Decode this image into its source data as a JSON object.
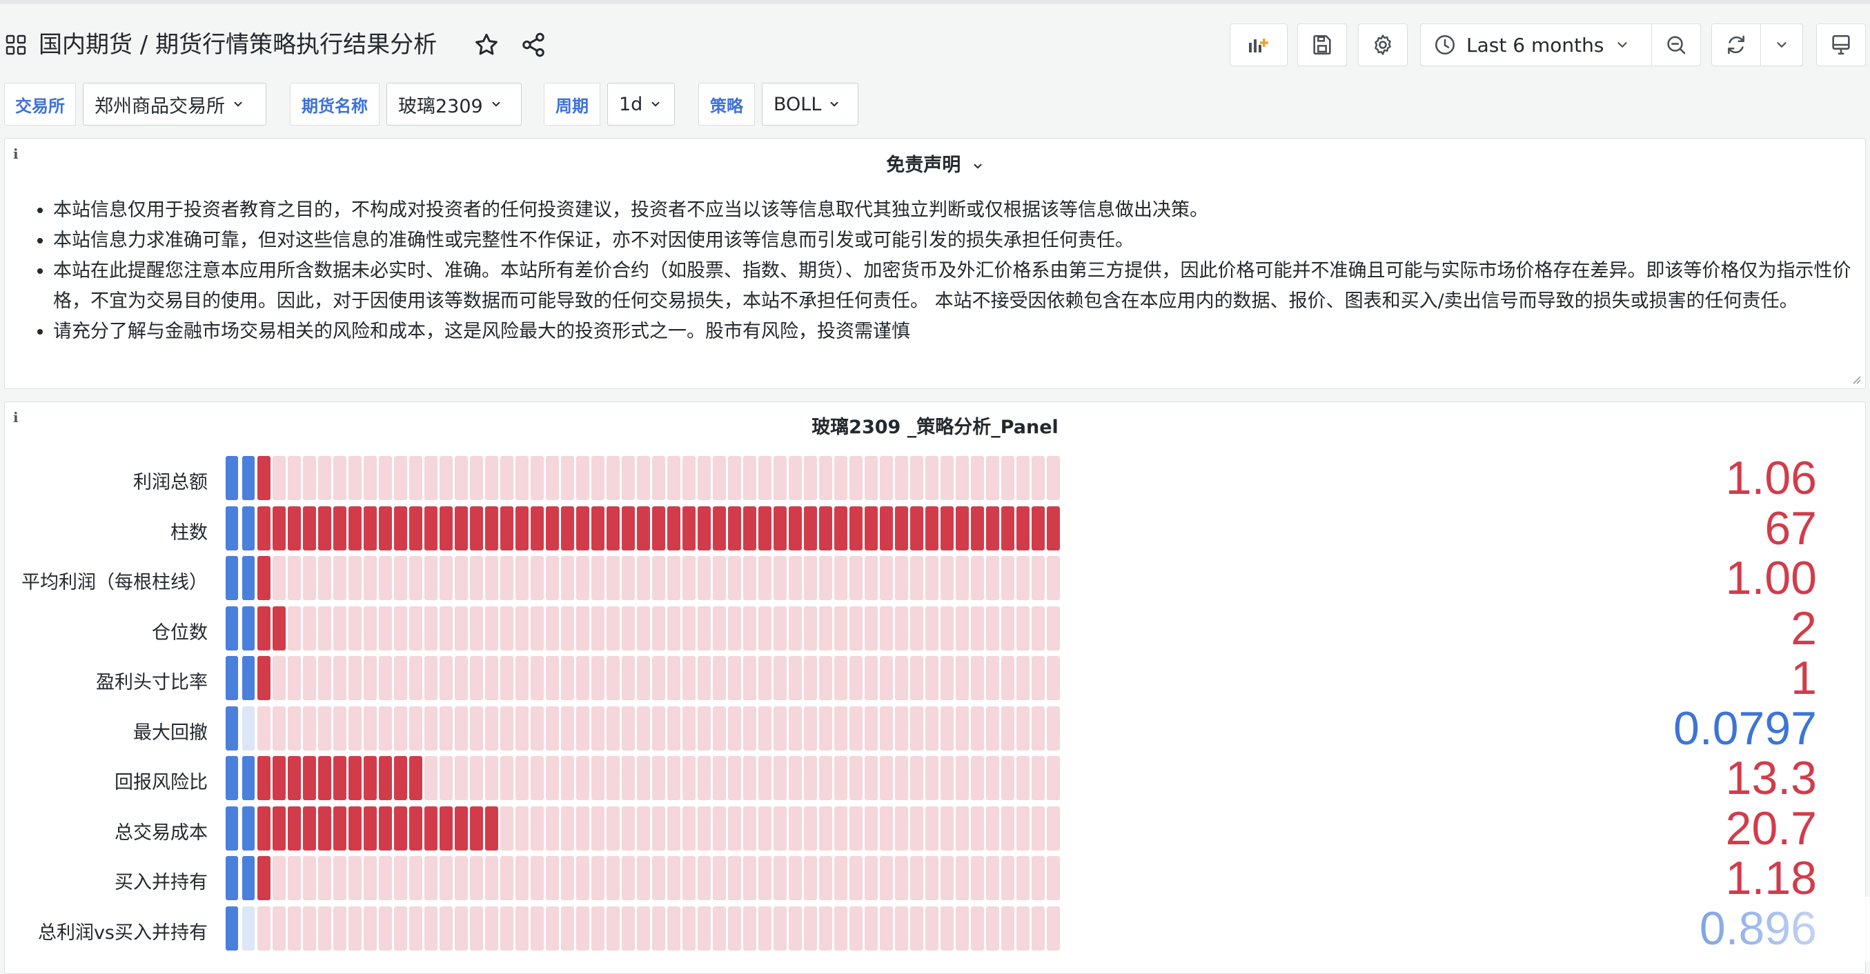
{
  "header": {
    "title": "国内期货  / 期货行情策略执行结果分析",
    "time_range": "Last 6 months"
  },
  "variables": [
    {
      "label": "交易所",
      "value": "郑州商品交易所"
    },
    {
      "label": "期货名称",
      "value": "玻璃2309"
    },
    {
      "label": "周期",
      "value": "1d"
    },
    {
      "label": "策略",
      "value": "BOLL"
    }
  ],
  "disclaimer": {
    "title": "免责声明",
    "items": [
      "本站信息仅用于投资者教育之目的，不构成对投资者的任何投资建议，投资者不应当以该等信息取代其独立判断或仅根据该等信息做出决策。",
      "本站信息力求准确可靠，但对这些信息的准确性或完整性不作保证，亦不对因使用该等信息而引发或可能引发的损失承担任何责任。",
      "本站在此提醒您注意本应用所含数据未必实时、准确。本站所有差价合约（如股票、指数、期货）、加密货币及外汇价格系由第三方提供，因此价格可能并不准确且可能与实际市场价格存在差异。即该等价格仅为指示性价格，不宜为交易目的使用。因此，对于因使用该等数据而可能导致的任何交易损失，本站不承担任何责任。 本站不接受因依赖包含在本应用内的数据、报价、图表和买入/卖出信号而导致的损失或损害的任何责任。",
      "请充分了解与金融市场交易相关的风险和成本，这是风险最大的投资形式之一。股市有风险，投资需谨慎"
    ]
  },
  "panel": {
    "title": "玻璃2309 _策略分析_Panel"
  },
  "colors": {
    "red": "#d23c4a",
    "red_light": "#f5d6da",
    "blue": "#4a7fdc",
    "blue_light": "#dbe6f7",
    "red_text": "#d23c4a",
    "blue_text": "#3e74d6"
  },
  "chart_data": {
    "type": "bar",
    "categories": [
      "利润总额",
      "柱数",
      "平均利润（每根柱线）",
      "仓位数",
      "盈利头寸比率",
      "最大回撤",
      "回报风险比",
      "总交易成本",
      "买入并持有",
      "总利润vs买入并持有"
    ],
    "value_labels": [
      "1.06",
      "67",
      "1.00",
      "2",
      "1",
      "0.0797",
      "13.3",
      "20.7",
      "1.18",
      "0.896"
    ],
    "values": [
      1.06,
      67,
      1.0,
      2,
      1,
      0.0797,
      13.3,
      20.7,
      1.18,
      0.896
    ],
    "value_colors": [
      "red",
      "red",
      "red",
      "red",
      "red",
      "blue",
      "red",
      "red",
      "red",
      "blue"
    ],
    "xlim": [
      0,
      67
    ]
  }
}
